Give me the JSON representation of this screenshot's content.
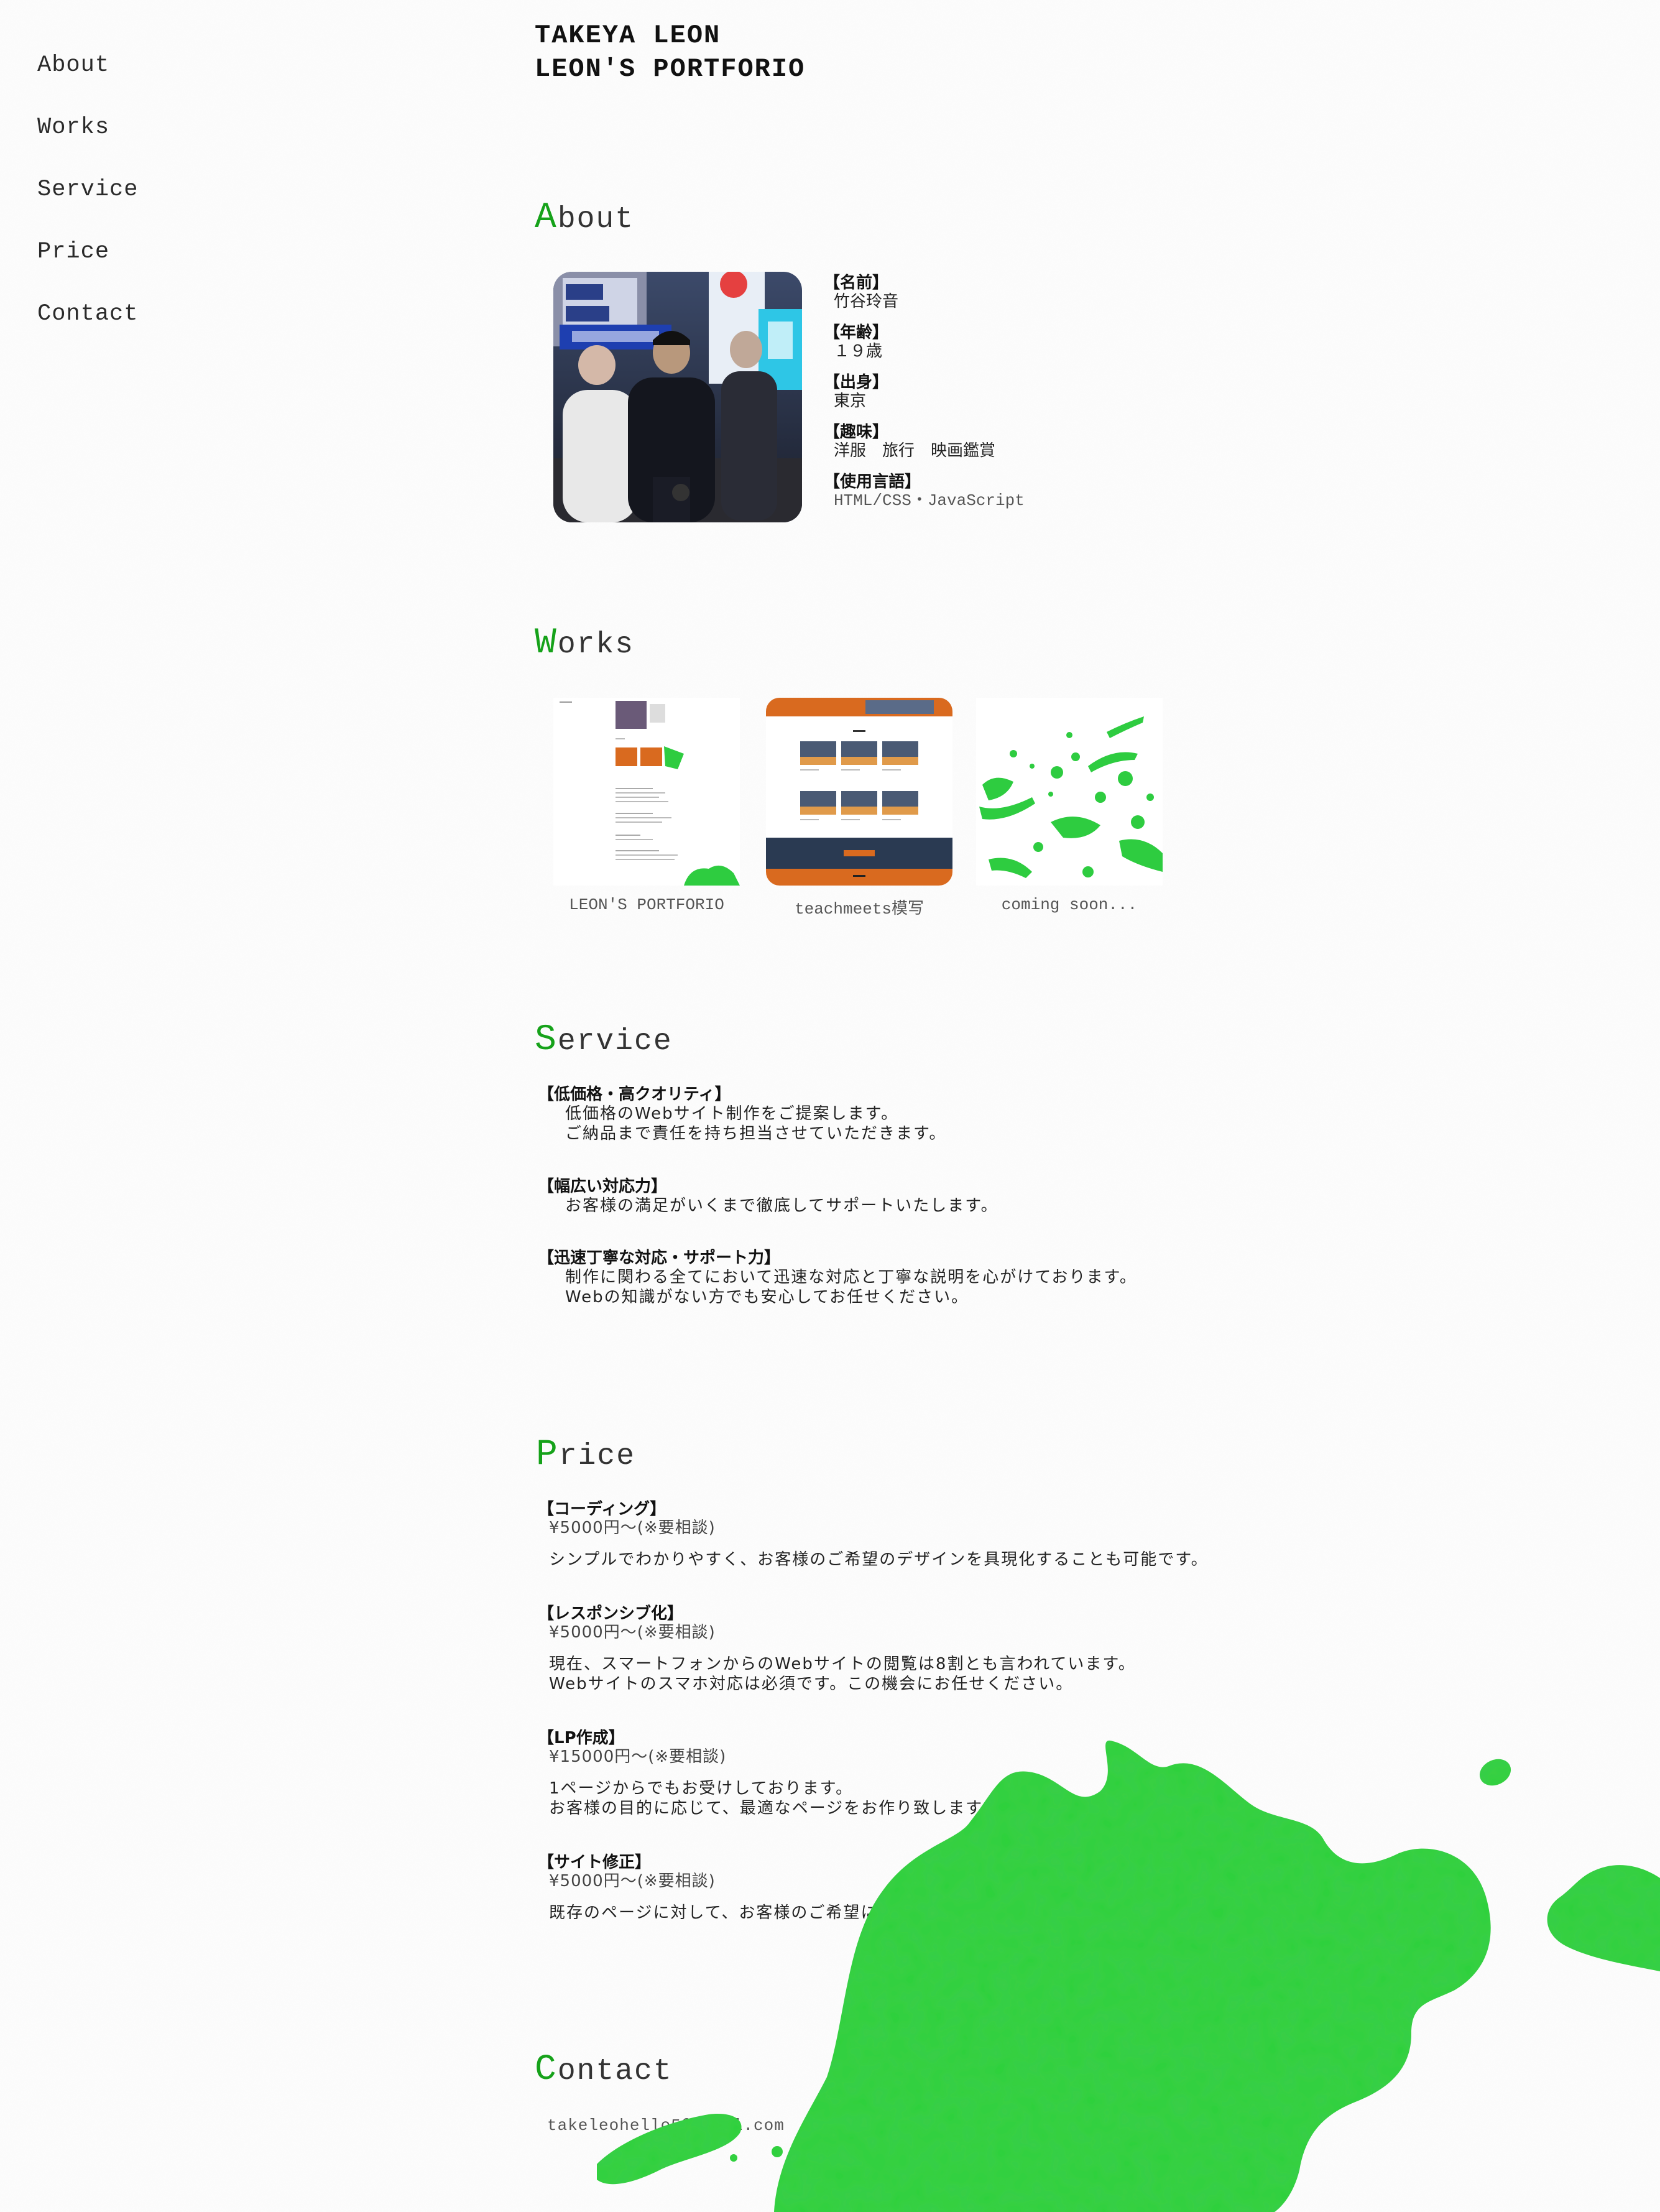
{
  "colors": {
    "accent": "#16a21a",
    "splatter": "#2ecc40",
    "background": "#fcfcfc"
  },
  "nav": {
    "about": "About",
    "works": "Works",
    "service": "Service",
    "price": "Price",
    "contact": "Contact"
  },
  "header": {
    "name": "TAKEYA LEON",
    "site_title": "LEON'S PORTFORIO"
  },
  "about": {
    "title_first": "A",
    "title_rest": "bout",
    "items": [
      {
        "label": "【名前】",
        "value": "竹谷玲音"
      },
      {
        "label": "【年齢】",
        "value": "１９歳"
      },
      {
        "label": "【出身】",
        "value": "東京"
      },
      {
        "label": "【趣味】",
        "value": "洋服　旅行　映画鑑賞"
      },
      {
        "label": "【使用言語】",
        "value": "HTML/CSS・JavaScript"
      }
    ]
  },
  "works": {
    "title_first": "W",
    "title_rest": "orks",
    "items": [
      {
        "label": "LEON'S PORTFORIO"
      },
      {
        "label": "teachmeets模写"
      },
      {
        "label": "coming soon..."
      }
    ]
  },
  "service": {
    "title_first": "S",
    "title_rest": "ervice",
    "items": [
      {
        "heading": "【低価格・高クオリティ】",
        "line1": "低価格のWebサイト制作をご提案します。",
        "line2": "ご納品まで責任を持ち担当させていただきます。"
      },
      {
        "heading": "【幅広い対応力】",
        "line1": "お客様の満足がいくまで徹底してサポートいたします。",
        "line2": ""
      },
      {
        "heading": "【迅速丁寧な対応・サポート力】",
        "line1": "制作に関わる全てにおいて迅速な対応と丁寧な説明を心がけております。",
        "line2": "Webの知識がない方でも安心してお任せください。"
      }
    ]
  },
  "price": {
    "title_first": "P",
    "title_rest": "rice",
    "items": [
      {
        "heading": "【コーディング】",
        "price": "¥5000円〜(※要相談)",
        "line1": "シンプルでわかりやすく、お客様のご希望のデザインを具現化することも可能です。",
        "line2": ""
      },
      {
        "heading": "【レスポンシブ化】",
        "price": "¥5000円〜(※要相談)",
        "line1": "現在、スマートフォンからのWebサイトの閲覧は8割とも言われています。",
        "line2": "Webサイトのスマホ対応は必須です。この機会にお任せください。"
      },
      {
        "heading": "【LP作成】",
        "price": "¥15000円〜(※要相談)",
        "line1": "1ページからでもお受けしております。",
        "line2": "お客様の目的に応じて、最適なページをお作り致します。"
      },
      {
        "heading": "【サイト修正】",
        "price": "¥5000円〜(※要相談)",
        "line1": "既存のページに対して、お客様のご希望に沿った修正を致します。",
        "line2": ""
      }
    ]
  },
  "contact": {
    "title_first": "C",
    "title_rest": "ontact",
    "email": "takeleohello5@gmail.com"
  }
}
